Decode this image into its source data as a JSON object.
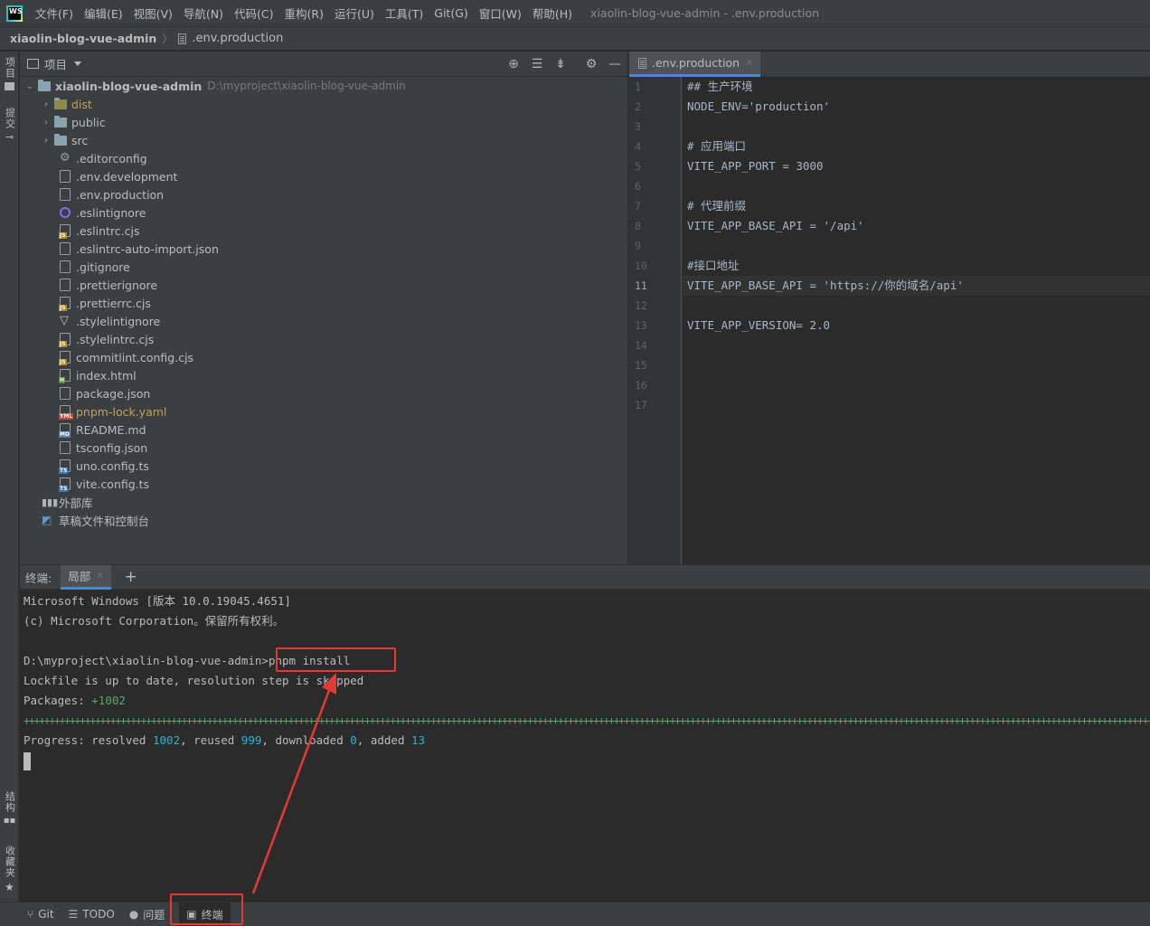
{
  "menubar": {
    "logo": "WS",
    "items": [
      "文件(F)",
      "编辑(E)",
      "视图(V)",
      "导航(N)",
      "代码(C)",
      "重构(R)",
      "运行(U)",
      "工具(T)",
      "Git(G)",
      "窗口(W)",
      "帮助(H)"
    ],
    "window_title": "xiaolin-blog-vue-admin - .env.production"
  },
  "navbar": {
    "project": "xiaolin-blog-vue-admin",
    "file": ".env.production"
  },
  "left_stripe": {
    "project_tab": "项目",
    "commit_tab": "提交",
    "structure_tab": "结构",
    "favorites_tab": "收藏夹"
  },
  "project_panel": {
    "title": "项目",
    "root": {
      "name": "xiaolin-blog-vue-admin",
      "path": "D:\\myproject\\xiaolin-blog-vue-admin"
    },
    "folders": [
      "dist",
      "public",
      "src"
    ],
    "files": [
      {
        "name": ".editorconfig",
        "icon": "gear-icon"
      },
      {
        "name": ".env.development",
        "icon": "file-icon"
      },
      {
        "name": ".env.production",
        "icon": "file-icon"
      },
      {
        "name": ".eslintignore",
        "icon": "eslint-icon"
      },
      {
        "name": ".eslintrc.cjs",
        "icon": "js-file-icon"
      },
      {
        "name": ".eslintrc-auto-import.json",
        "icon": "json-file-icon"
      },
      {
        "name": ".gitignore",
        "icon": "gitignore-icon"
      },
      {
        "name": ".prettierignore",
        "icon": "file-icon"
      },
      {
        "name": ".prettierrc.cjs",
        "icon": "js-file-icon"
      },
      {
        "name": ".stylelintignore",
        "icon": "stylelint-icon"
      },
      {
        "name": ".stylelintrc.cjs",
        "icon": "js-file-icon"
      },
      {
        "name": "commitlint.config.cjs",
        "icon": "js-file-icon"
      },
      {
        "name": "index.html",
        "icon": "html-file-icon"
      },
      {
        "name": "package.json",
        "icon": "json-file-icon"
      },
      {
        "name": "pnpm-lock.yaml",
        "icon": "yaml-file-icon"
      },
      {
        "name": "README.md",
        "icon": "md-file-icon"
      },
      {
        "name": "tsconfig.json",
        "icon": "json-file-icon"
      },
      {
        "name": "uno.config.ts",
        "icon": "ts-file-icon"
      },
      {
        "name": "vite.config.ts",
        "icon": "ts-file-icon"
      }
    ],
    "external_libs": "外部库",
    "scratches": "草稿文件和控制台"
  },
  "editor": {
    "tab": ".env.production",
    "active_line": 11,
    "line_numbers": [
      "1",
      "2",
      "3",
      "4",
      "5",
      "6",
      "7",
      "8",
      "9",
      "10",
      "11",
      "12",
      "13",
      "14",
      "15",
      "16",
      "17"
    ],
    "lines": [
      "## 生产环境",
      "NODE_ENV='production'",
      "",
      "# 应用端口",
      "VITE_APP_PORT = 3000",
      "",
      "# 代理前缀",
      "VITE_APP_BASE_API = '/api'",
      "",
      "#接口地址",
      "VITE_APP_BASE_API = 'https://你的域名/api'",
      "",
      "VITE_APP_VERSION= 2.0",
      "",
      "",
      "",
      ""
    ]
  },
  "terminal": {
    "label": "终端:",
    "tab": "局部",
    "line1": "Microsoft Windows [版本 10.0.19045.4651]",
    "line2": "(c) Microsoft Corporation。保留所有权利。",
    "prompt": "D:\\myproject\\xiaolin-blog-vue-admin>",
    "command": "pnpm install",
    "lockfile_msg": "Lockfile is up to date, resolution step is skipped",
    "packages_label": "Packages: ",
    "packages_value": "+1002",
    "progress": {
      "label": "Progress: resolved ",
      "resolved": "1002",
      "reused_label": ", reused ",
      "reused": "999",
      "downloaded_label": ", downloaded ",
      "downloaded": "0",
      "added_label": ", added ",
      "added": "13"
    }
  },
  "bottom_bar": {
    "git": "Git",
    "todo": "TODO",
    "problems": "问题",
    "terminal": "终端"
  },
  "annotation_color": "#e53935"
}
